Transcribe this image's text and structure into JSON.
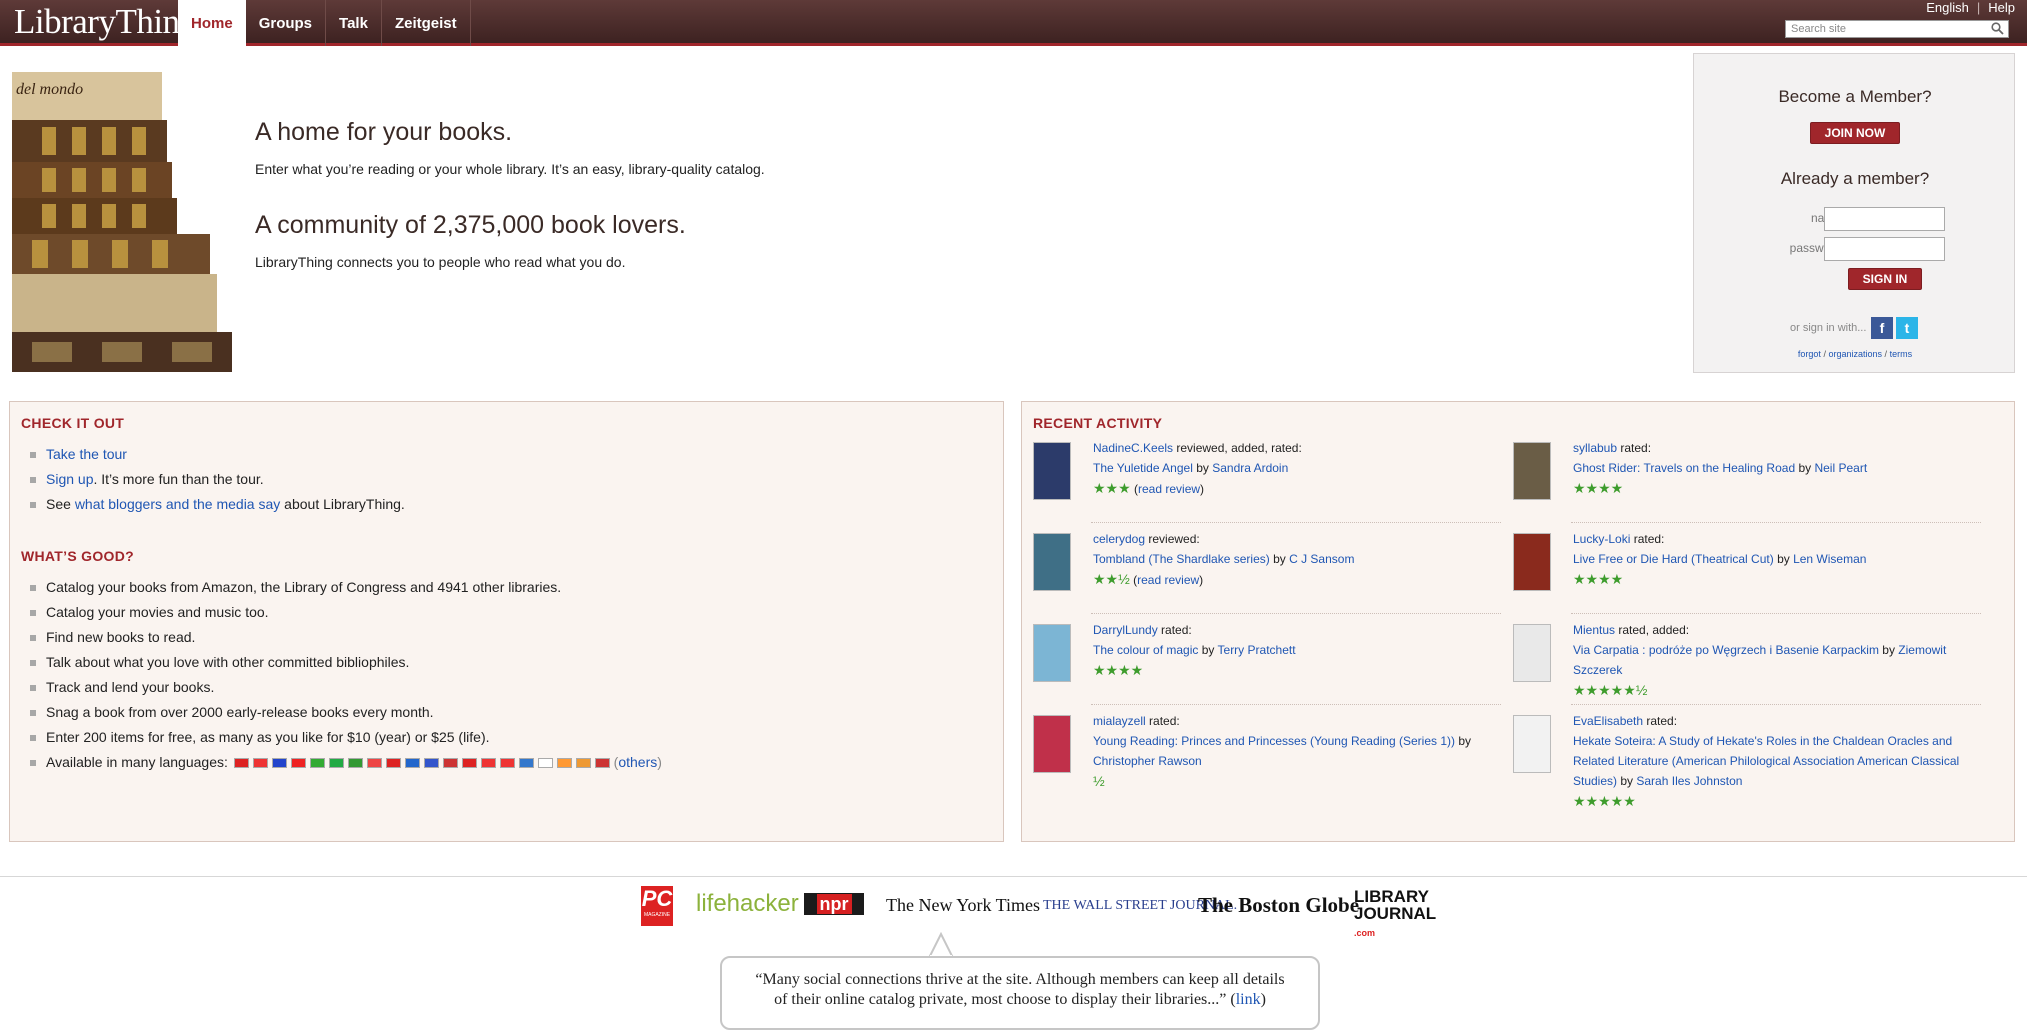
{
  "header": {
    "logo": "LibraryThing",
    "tabs": [
      {
        "label": "Home"
      },
      {
        "label": "Groups"
      },
      {
        "label": "Talk"
      },
      {
        "label": "Zeitgeist"
      }
    ],
    "language_link": "English",
    "help_link": "Help",
    "search_placeholder": "Search site"
  },
  "hero": {
    "heading1": "A home for your books.",
    "text1": "Enter what you’re reading or your whole library. It’s an easy, library-quality catalog.",
    "heading2": "A community of 2,375,000 book lovers.",
    "text2": "LibraryThing connects you to people who read what you do."
  },
  "login": {
    "become_member": "Become a Member?",
    "join_button": "JOIN NOW",
    "already_member": "Already a member?",
    "name_label": "name",
    "password_label": "password",
    "signin_button": "SIGN IN",
    "signin_with": "or sign in with...",
    "forgot": "forgot",
    "organizations": "organizations",
    "terms": "terms",
    "sep": "/"
  },
  "check_it_out": {
    "title": "CHECK IT OUT",
    "tour_link": "Take the tour",
    "signup_link": "Sign up",
    "signup_suffix": ". It’s more fun than the tour.",
    "see_prefix": "See ",
    "bloggers_link": "what bloggers and the media say",
    "see_suffix": " about LibraryThing."
  },
  "whats_good": {
    "title": "WHAT’S GOOD?",
    "items": [
      "Catalog your books from Amazon, the Library of Congress and 4941 other libraries.",
      "Catalog your movies and music too.",
      "Find new books to read.",
      "Talk about what you love with other committed bibliophiles.",
      "Track and lend your books.",
      "Snag a book from over 2000 early-release books every month.",
      "Enter 200 items for free, as many as you like for $10 (year) or $25 (life)."
    ],
    "languages_label": "Available in many languages:",
    "flag_colors": [
      "#d22",
      "#e33",
      "#24c",
      "#e22",
      "#3a3",
      "#2a4",
      "#393",
      "#e44",
      "#d22",
      "#26c",
      "#35c",
      "#c33",
      "#d22",
      "#e33",
      "#e33",
      "#37c",
      "#fff",
      "#f93",
      "#e93",
      "#c33"
    ],
    "others_link": "others"
  },
  "recent_activity": {
    "title": "RECENT ACTIVITY",
    "items": [
      {
        "user": "NadineC.Keels",
        "action": " reviewed, added, rated:",
        "title": "The Yuletide Angel",
        "by": " by ",
        "author": "Sandra Ardoin",
        "stars": "★★★",
        "review_link": "read review",
        "cover_color": "#2c3b6a"
      },
      {
        "user": "syllabub",
        "action": " rated:",
        "title": "Ghost Rider: Travels on the Healing Road",
        "by": " by ",
        "author": "Neil Peart",
        "stars": "★★★★",
        "review_link": "",
        "cover_color": "#6a5d46"
      },
      {
        "user": "celerydog",
        "action": " reviewed:",
        "title": "Tombland (The Shardlake series)",
        "by": " by ",
        "author": "C J Sansom",
        "stars": "★★½",
        "review_link": "read review",
        "cover_color": "#3f6f86"
      },
      {
        "user": "Lucky-Loki",
        "action": " rated:",
        "title": "Live Free or Die Hard (Theatrical Cut)",
        "by": " by ",
        "author": "Len Wiseman",
        "stars": "★★★★",
        "review_link": "",
        "cover_color": "#8a2a1d"
      },
      {
        "user": "DarrylLundy",
        "action": " rated:",
        "title": "The colour of magic",
        "by": " by ",
        "author": "Terry Pratchett",
        "stars": "★★★★",
        "review_link": "",
        "cover_color": "#7cb5d4"
      },
      {
        "user": "Mientus",
        "action": " rated, added:",
        "title": "Via Carpatia : podróże po Węgrzech i Basenie Karpackim",
        "by": " by ",
        "author": "Ziemowit Szczerek",
        "stars": "★★★★★½",
        "review_link": "",
        "cover_color": "#e9e9e9"
      },
      {
        "user": "mialayzell",
        "action": " rated:",
        "title": "Young Reading: Princes and Princesses (Young Reading (Series 1))",
        "by": " by ",
        "author": "Christopher Rawson",
        "stars": "½",
        "review_link": "",
        "cover_color": "#c0304a"
      },
      {
        "user": "EvaElisabeth",
        "action": " rated:",
        "title": "Hekate Soteira: A Study of Hekate's Roles in the Chaldean Oracles and Related Literature (American Philological Association American Classical Studies)",
        "by": " by ",
        "author": "Sarah Iles Johnston",
        "stars": "★★★★★",
        "review_link": "",
        "cover_color": "#f2f2f2"
      }
    ]
  },
  "press": {
    "logos": [
      {
        "name": "PC",
        "sub": "MAGAZINE"
      },
      {
        "name": "lifehacker"
      },
      {
        "name": "npr"
      },
      {
        "name": "The New York Times"
      },
      {
        "name": "THE WALL STREET JOURNAL."
      },
      {
        "name": "The Boston Globe"
      },
      {
        "name": "LIBRARY JOURNAL",
        "sub": ".com"
      }
    ],
    "quote_line1": "“Many social connections thrive at the site. Although members can keep all details",
    "quote_line2": "of their online catalog private, most choose to display their libraries...” (",
    "quote_link": "link",
    "quote_end": ")"
  }
}
